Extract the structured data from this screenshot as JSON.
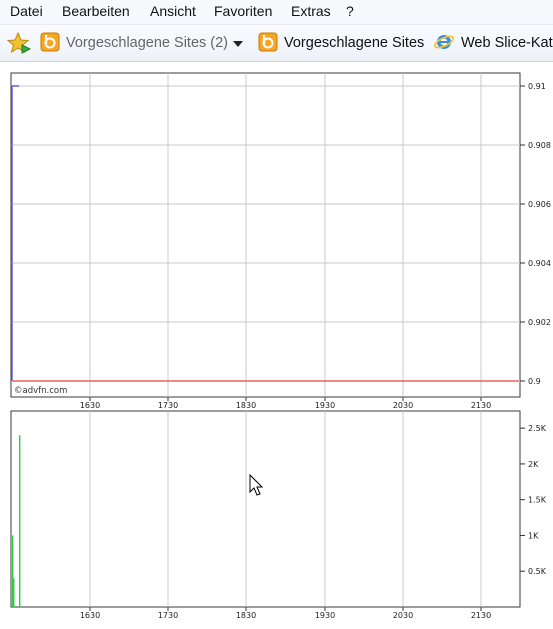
{
  "menu": {
    "items": [
      "Datei",
      "Bearbeiten",
      "Ansicht",
      "Favoriten",
      "Extras",
      "?"
    ]
  },
  "favorites_bar": {
    "suggested_sites_dropdown": "Vorgeschlagene Sites (2)",
    "suggested_sites": "Vorgeschlagene Sites",
    "web_slice_gallery": "Web Slice-Kat"
  },
  "colors": {
    "price_line": "#5b5bd6",
    "reference_line": "#e8625a",
    "volume_bars": "#2ecc40",
    "grid": "#c8c8c8"
  },
  "chart_data": [
    {
      "type": "line",
      "title": "",
      "watermark": "©advfn.com",
      "x_tick_labels": [
        "1630",
        "1730",
        "1830",
        "1930",
        "2030",
        "2130"
      ],
      "y_tick_labels": [
        "0.91",
        "0.908",
        "0.906",
        "0.904",
        "0.902",
        "0.9"
      ],
      "ylim": [
        0.9,
        0.91
      ],
      "series": [
        {
          "role": "price",
          "color": "#5b5bd6",
          "points": [
            [
              0,
              0.9
            ],
            [
              0,
              0.91
            ],
            [
              1,
              0.91
            ]
          ]
        },
        {
          "role": "reference",
          "color": "#e8625a",
          "points": [
            [
              0,
              0.9
            ],
            [
              1,
              0.9
            ]
          ]
        }
      ],
      "grid": true
    },
    {
      "type": "bar",
      "x_tick_labels": [
        "1630",
        "1730",
        "1830",
        "1930",
        "2030",
        "2130"
      ],
      "y_tick_labels": [
        "2.5K",
        "2K",
        "1.5K",
        "1K",
        "0.5K"
      ],
      "ylim": [
        0,
        2600
      ],
      "values": [
        2400,
        400,
        1000
      ],
      "grid": true
    }
  ]
}
